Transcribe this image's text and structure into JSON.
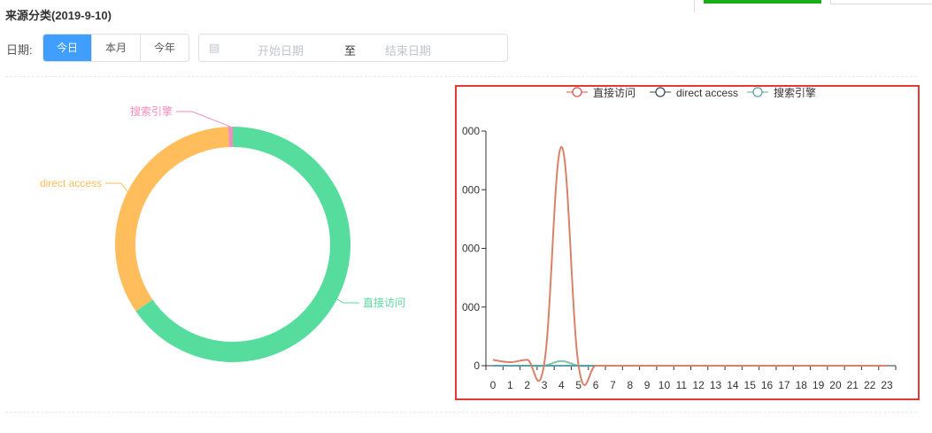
{
  "header": {
    "title": "来源分类(2019-9-10)"
  },
  "filters": {
    "date_label": "日期:",
    "buttons": [
      "今日",
      "本月",
      "今年"
    ],
    "active": 0,
    "start_placeholder": "开始日期",
    "separator": "至",
    "end_placeholder": "结束日期",
    "calendar_icon": "calendar-icon"
  },
  "colors": {
    "primary": "#409eff",
    "green": "#56dd9e",
    "yellow": "#ffbd5c",
    "pink": "#f38cbf",
    "line_red": "#d9826a",
    "line_teal": "#5c9fa8",
    "highlight": "#e53935"
  },
  "chart_data": [
    {
      "type": "pie",
      "donut": true,
      "labels": [
        "直接访问",
        "direct access",
        "搜索引擎"
      ],
      "values": [
        65.4,
        34.0,
        0.6
      ],
      "colors": [
        "#56dd9e",
        "#ffbd5c",
        "#f38cbf"
      ]
    },
    {
      "type": "line",
      "legend": [
        "直接访问",
        "direct access",
        "搜索引擎"
      ],
      "legend_placement": "top-center",
      "x": [
        "0",
        "1",
        "2",
        "3",
        "4",
        "5",
        "6",
        "7",
        "8",
        "9",
        "10",
        "11",
        "12",
        "13",
        "14",
        "15",
        "16",
        "17",
        "18",
        "19",
        "20",
        "21",
        "22",
        "23"
      ],
      "y_ticks": [
        "0",
        "000",
        "000",
        "000",
        "000"
      ],
      "ylim": [
        0,
        4000
      ],
      "series": [
        {
          "name": "直接访问",
          "color": "#d9826a",
          "values": [
            100,
            60,
            100,
            50,
            3730,
            0,
            0,
            0,
            0,
            0,
            0,
            0,
            0,
            0,
            0,
            0,
            0,
            0,
            0,
            0,
            0,
            0,
            0,
            0
          ]
        },
        {
          "name": "direct access",
          "color": "#3b4a5a",
          "values": [
            0,
            0,
            0,
            0,
            0,
            0,
            0,
            0,
            0,
            0,
            0,
            0,
            0,
            0,
            0,
            0,
            0,
            0,
            0,
            0,
            0,
            0,
            0,
            0
          ]
        },
        {
          "name": "搜索引擎",
          "color": "#7cc6a8",
          "values": [
            0,
            0,
            0,
            0,
            80,
            0,
            0,
            0,
            0,
            0,
            0,
            0,
            0,
            0,
            0,
            0,
            0,
            0,
            0,
            0,
            0,
            0,
            0,
            0
          ]
        }
      ]
    }
  ]
}
